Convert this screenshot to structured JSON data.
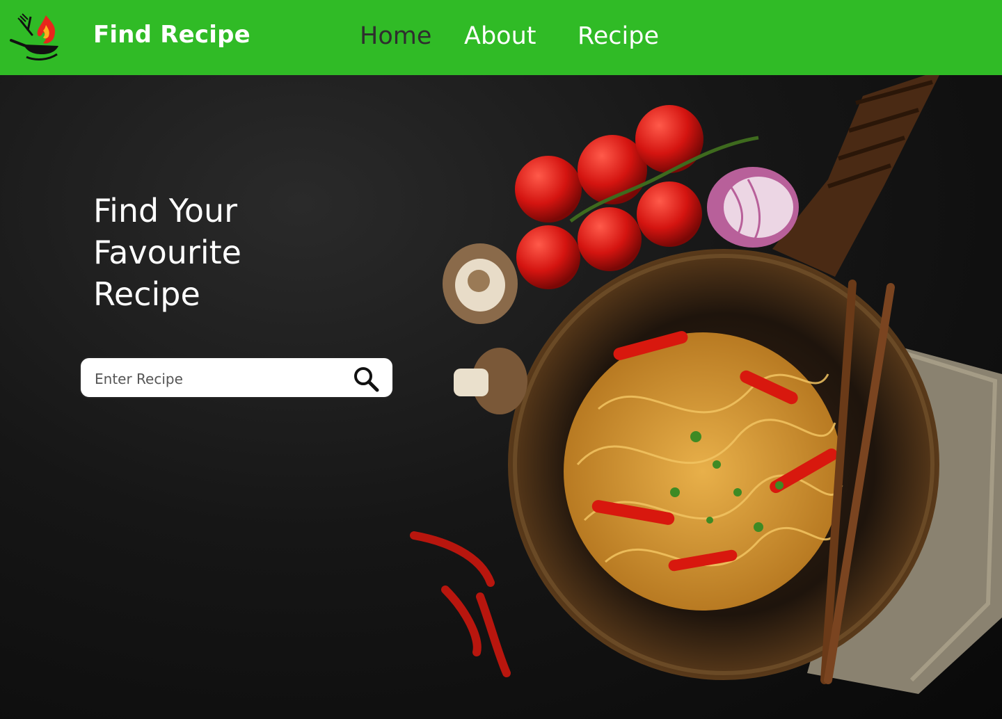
{
  "navbar": {
    "brand": "Find Recipe",
    "links": [
      {
        "label": "Home",
        "active": true
      },
      {
        "label": "About",
        "active": false
      },
      {
        "label": "Recipe",
        "active": false
      }
    ],
    "bg_color": "#30bb26",
    "logo_icon": "flaming-wok-logo"
  },
  "hero": {
    "headline": [
      "Find Your",
      "Favourite",
      "Recipe"
    ],
    "background_image": "noodle-stir-fry-wok-with-tomatoes-onion-mushrooms-chili-chopsticks"
  },
  "search": {
    "placeholder": "Enter Recipe",
    "value": "",
    "icon": "search-icon"
  }
}
